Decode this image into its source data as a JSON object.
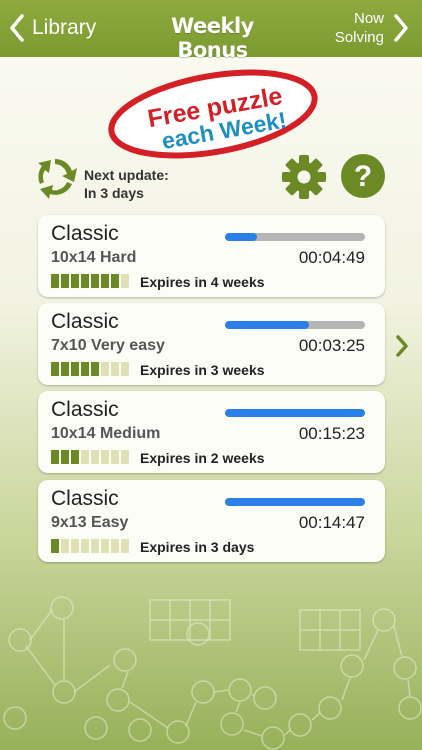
{
  "nav": {
    "back_label": "Library",
    "title": "Weekly Bonus",
    "forward_line1": "Now",
    "forward_line2": "Solving"
  },
  "badge": {
    "line1": "Free puzzle",
    "line2": "each Week!",
    "colors": {
      "free": "#d41f26",
      "puzzle": "#1f8fbf",
      "ring": "#d41f26"
    }
  },
  "update": {
    "line1": "Next update:",
    "line2": "In 3 days"
  },
  "icons": [
    "refresh-icon",
    "gear-icon",
    "help-icon",
    "chevron-right-icon",
    "chevron-left-icon"
  ],
  "colors": {
    "accent": "#7a9a30",
    "progress": "#2a7fe8",
    "track": "#b5b5b5",
    "block_on": "#6b8a25",
    "block_off": "#dfe1b4"
  },
  "puzzles": [
    {
      "title": "Classic",
      "size": "10x14 Hard",
      "time": "00:04:49",
      "progress": 0.23,
      "expires": "Expires in 4 weeks",
      "blocks_filled": 7,
      "blocks_total": 8
    },
    {
      "title": "Classic",
      "size": "7x10 Very easy",
      "time": "00:03:25",
      "progress": 0.6,
      "expires": "Expires in 3 weeks",
      "blocks_filled": 5,
      "blocks_total": 8
    },
    {
      "title": "Classic",
      "size": "10x14 Medium",
      "time": "00:15:23",
      "progress": 1.0,
      "expires": "Expires in 2 weeks",
      "blocks_filled": 3,
      "blocks_total": 8
    },
    {
      "title": "Classic",
      "size": "9x13 Easy",
      "time": "00:14:47",
      "progress": 1.0,
      "expires": "Expires in 3 days",
      "blocks_filled": 1,
      "blocks_total": 8
    }
  ]
}
